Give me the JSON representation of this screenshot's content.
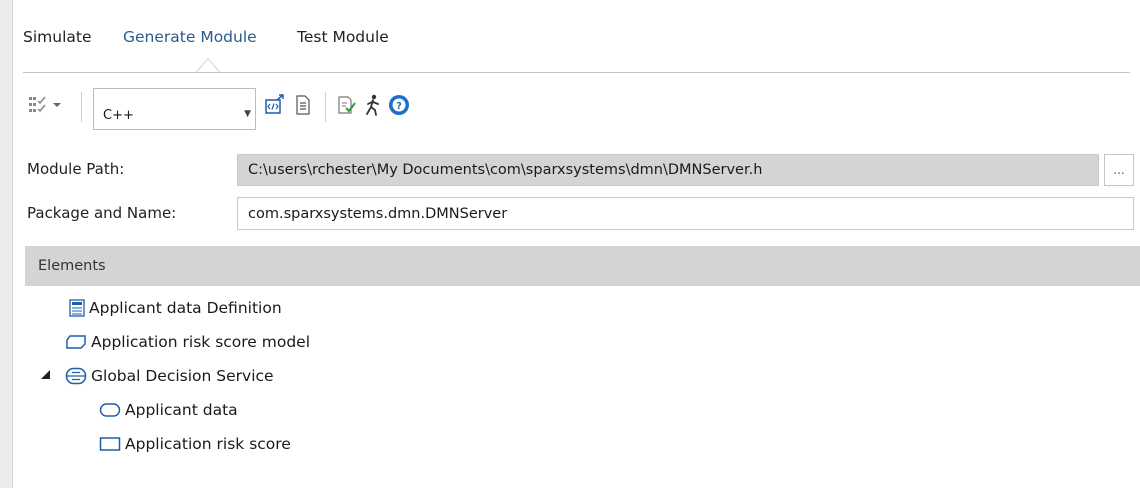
{
  "tabs": [
    "Simulate",
    "Generate Module",
    "Test Module"
  ],
  "active_tab": "Generate Module",
  "toolbar": {
    "language": "C++",
    "icons": [
      "element-options-icon",
      "dropdown-arrow-icon",
      "generate-code-icon",
      "view-source-icon",
      "validate-icon",
      "run-icon",
      "help-icon"
    ]
  },
  "form": {
    "module_path_label": "Module Path:",
    "module_path_value": "C:\\users\\rchester\\My Documents\\com\\sparxsystems\\dmn\\DMNServer.h",
    "browse_label": "...",
    "package_label": "Package and Name:",
    "package_value": "com.sparxsystems.dmn.DMNServer"
  },
  "elements": {
    "header": "Elements",
    "items": [
      {
        "label": "Applicant data Definition",
        "icon": "item-definition-icon"
      },
      {
        "label": "Application risk score model",
        "icon": "business-knowledge-model-icon"
      },
      {
        "label": "Global Decision Service",
        "icon": "decision-service-icon",
        "expanded": true
      },
      {
        "label": "Applicant data",
        "icon": "input-data-icon"
      },
      {
        "label": "Application risk score",
        "icon": "decision-icon"
      }
    ]
  },
  "colors": {
    "active_tab": "#2b5c8a",
    "icon_blue": "#1f5fa8",
    "readonly_bg": "#d4d4d4"
  }
}
